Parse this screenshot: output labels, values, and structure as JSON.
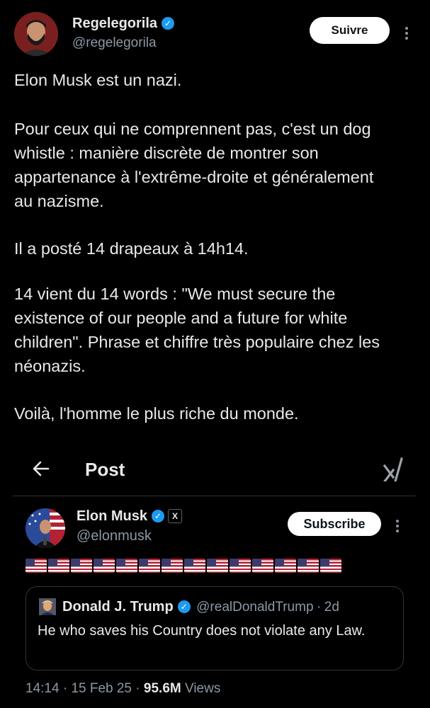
{
  "tweet": {
    "author_name": "Regelegorila",
    "author_handle": "@regelegorila",
    "follow_label": "Suivre",
    "paragraphs": [
      "Elon Musk est un nazi.",
      "Pour ceux qui ne comprennent pas, c'est un dog whistle : manière discrète de montrer son appartenance à l'extrême-droite et généralement au nazisme.",
      "Il a posté 14 drapeaux à 14h14.",
      "14 vient du 14 words : \"We must secure the existence of our people and a future for white children\". Phrase et chiffre très populaire chez les néonazis.",
      "Voilà, l'homme le plus riche du monde."
    ]
  },
  "embedded": {
    "title": "Post",
    "author_name": "Elon Musk",
    "author_handle": "@elonmusk",
    "x_badge": "X",
    "subscribe_label": "Subscribe",
    "flag_count": 14,
    "quote": {
      "author_name": "Donald J. Trump",
      "author_handle": "@realDonaldTrump",
      "separator": "·",
      "time": "2d",
      "text": "He who saves his Country does not violate any Law."
    },
    "meta": {
      "time": "14:14",
      "sep1": "·",
      "date": "15 Feb 25",
      "sep2": "·",
      "views_count": "95.6M",
      "views_label": "Views"
    }
  },
  "colors": {
    "background": "#000000",
    "text": "#e7e9ea",
    "secondary": "#8b98a5",
    "verified": "#1d9bf0"
  }
}
